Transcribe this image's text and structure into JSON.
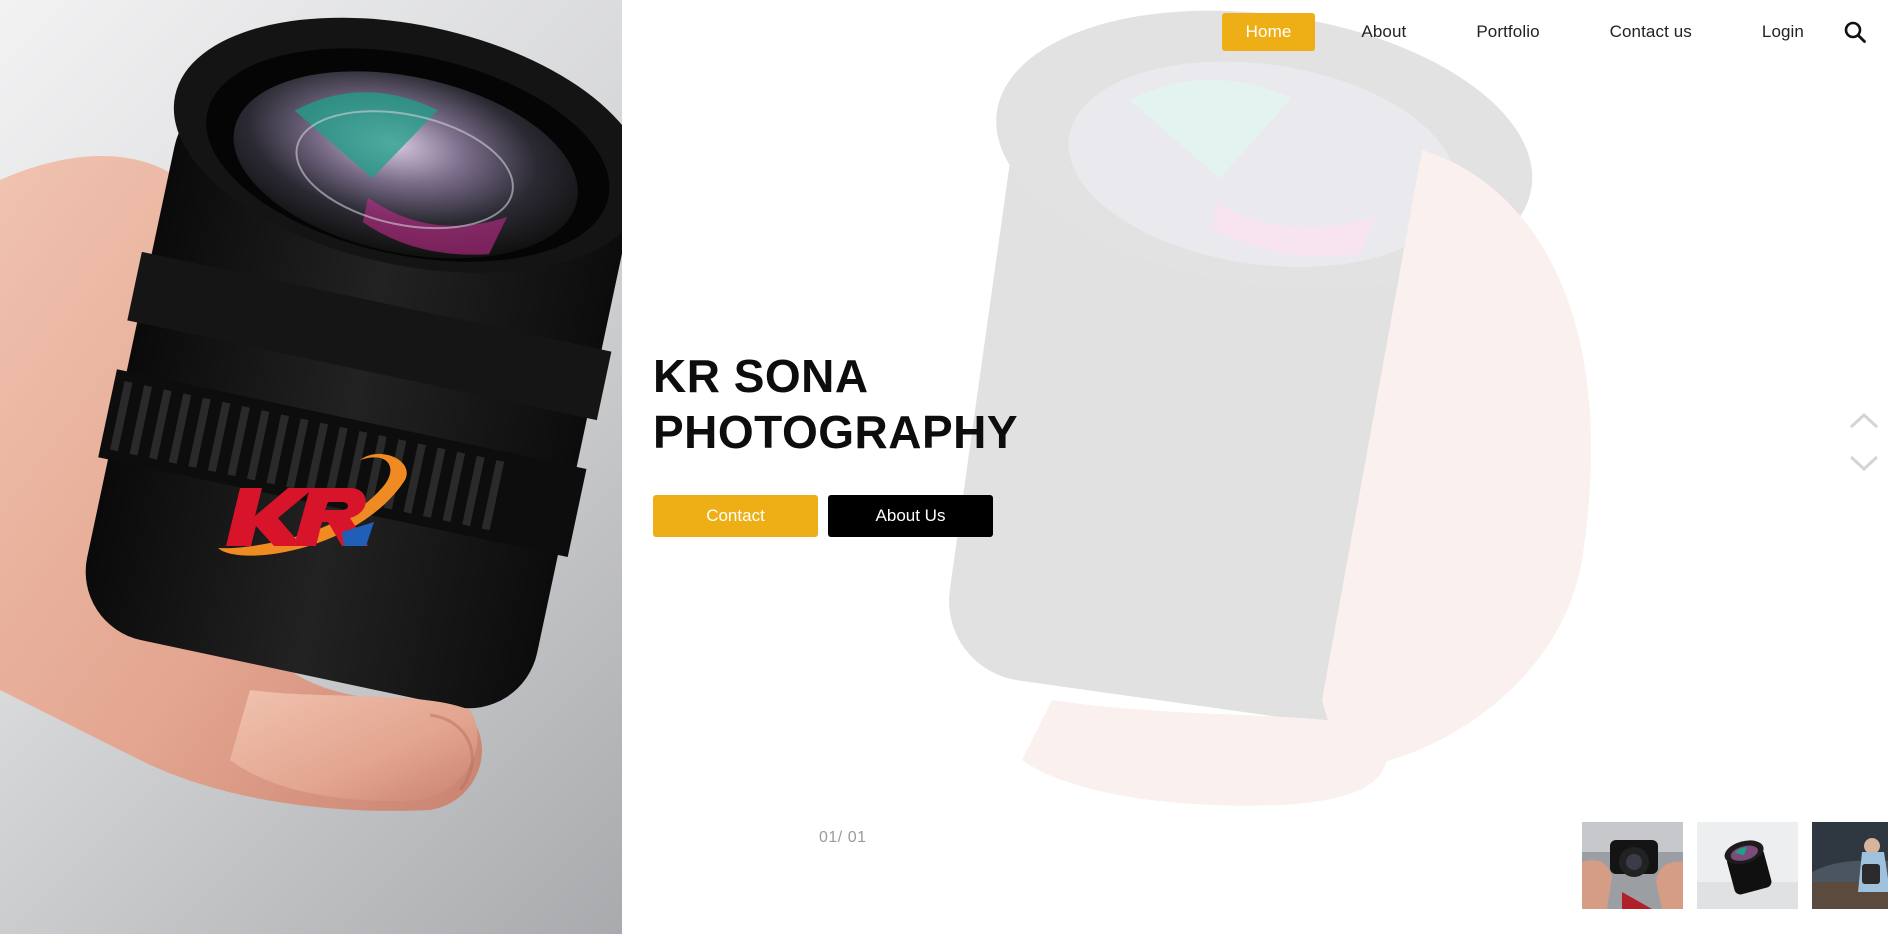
{
  "nav": {
    "items": [
      {
        "label": "Home",
        "active": true
      },
      {
        "label": "About",
        "active": false
      },
      {
        "label": "Portfolio",
        "active": false
      },
      {
        "label": "Contact us",
        "active": false
      },
      {
        "label": "Login",
        "active": false
      }
    ],
    "search_icon": "search-icon"
  },
  "hero": {
    "title_line1": "KR SONA",
    "title_line2": "PHOTOGRAPHY",
    "contact_label": "Contact",
    "about_label": "About Us"
  },
  "logo": {
    "text": "KR"
  },
  "slider": {
    "counter": "01/ 01",
    "up_icon": "chevron-up-icon",
    "down_icon": "chevron-down-icon",
    "thumbnails": [
      "camera-in-hands",
      "lens-on-table",
      "person-with-backpack"
    ]
  },
  "colors": {
    "accent": "#eeaf16",
    "dark": "#000000",
    "logo_red": "#d8142b",
    "logo_orange": "#f08a22",
    "logo_blue": "#1f5fb8"
  }
}
